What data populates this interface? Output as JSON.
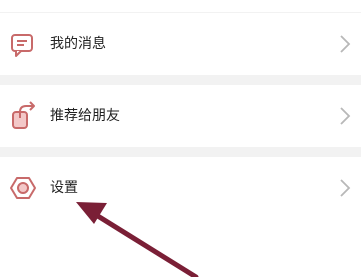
{
  "menu": {
    "items": [
      {
        "label": "我的消息",
        "icon": "message-icon"
      },
      {
        "label": "推荐给朋友",
        "icon": "share-icon"
      },
      {
        "label": "设置",
        "icon": "settings-icon"
      }
    ]
  },
  "colors": {
    "accent": "#c86a6a",
    "chevron": "#b8b8b8",
    "annotation_arrow": "#7a1f36",
    "row_background": "#ffffff",
    "divider_background": "#f2f2f2"
  }
}
